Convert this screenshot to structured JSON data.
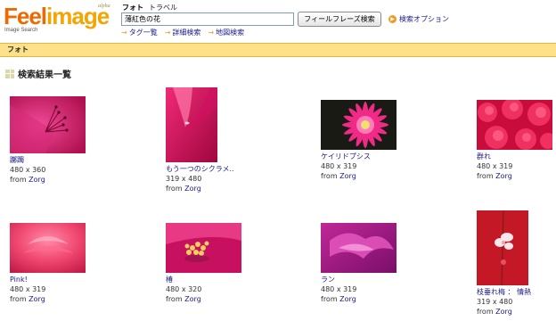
{
  "logo": {
    "brand_feel": "Feel",
    "brand_image": "image",
    "subtitle": "Image Search",
    "badge": "alpha"
  },
  "nav": {
    "tabs": [
      {
        "label": "フォト",
        "active": true
      },
      {
        "label": "トラベル",
        "active": false
      }
    ]
  },
  "search": {
    "value": "薄紅色の花",
    "button_label": "フィールフレーズ検索",
    "options_label": "検索オプション"
  },
  "sub_links": [
    "タグ一覧",
    "詳細検索",
    "地図検索"
  ],
  "category_bar": {
    "label": "フォト"
  },
  "results": {
    "heading": "検索結果一覧",
    "from_prefix": "from",
    "items": [
      {
        "title": "躑躅",
        "size": "480 x 360",
        "author": "Zorg"
      },
      {
        "title": "もう一つのシクラメ..",
        "size": "319 x 480",
        "author": "Zorg"
      },
      {
        "title": "ケイリドプシス",
        "size": "480 x 319",
        "author": "Zorg"
      },
      {
        "title": "群れ",
        "size": "480 x 319",
        "author": "Zorg"
      },
      {
        "title": "Pink!",
        "size": "480 x 319",
        "author": "Zorg"
      },
      {
        "title": "椿",
        "size": "480 x 320",
        "author": "Zorg"
      },
      {
        "title": "ラン",
        "size": "480 x 319",
        "author": "Zorg"
      },
      {
        "title": "枝垂れ梅 ： 情熱",
        "size": "319 x 480",
        "author": "Zorg"
      }
    ]
  },
  "colors": {
    "link": "#1a1a8a",
    "brand_orange": "#f28c00",
    "category_bar": "#fde08a"
  }
}
